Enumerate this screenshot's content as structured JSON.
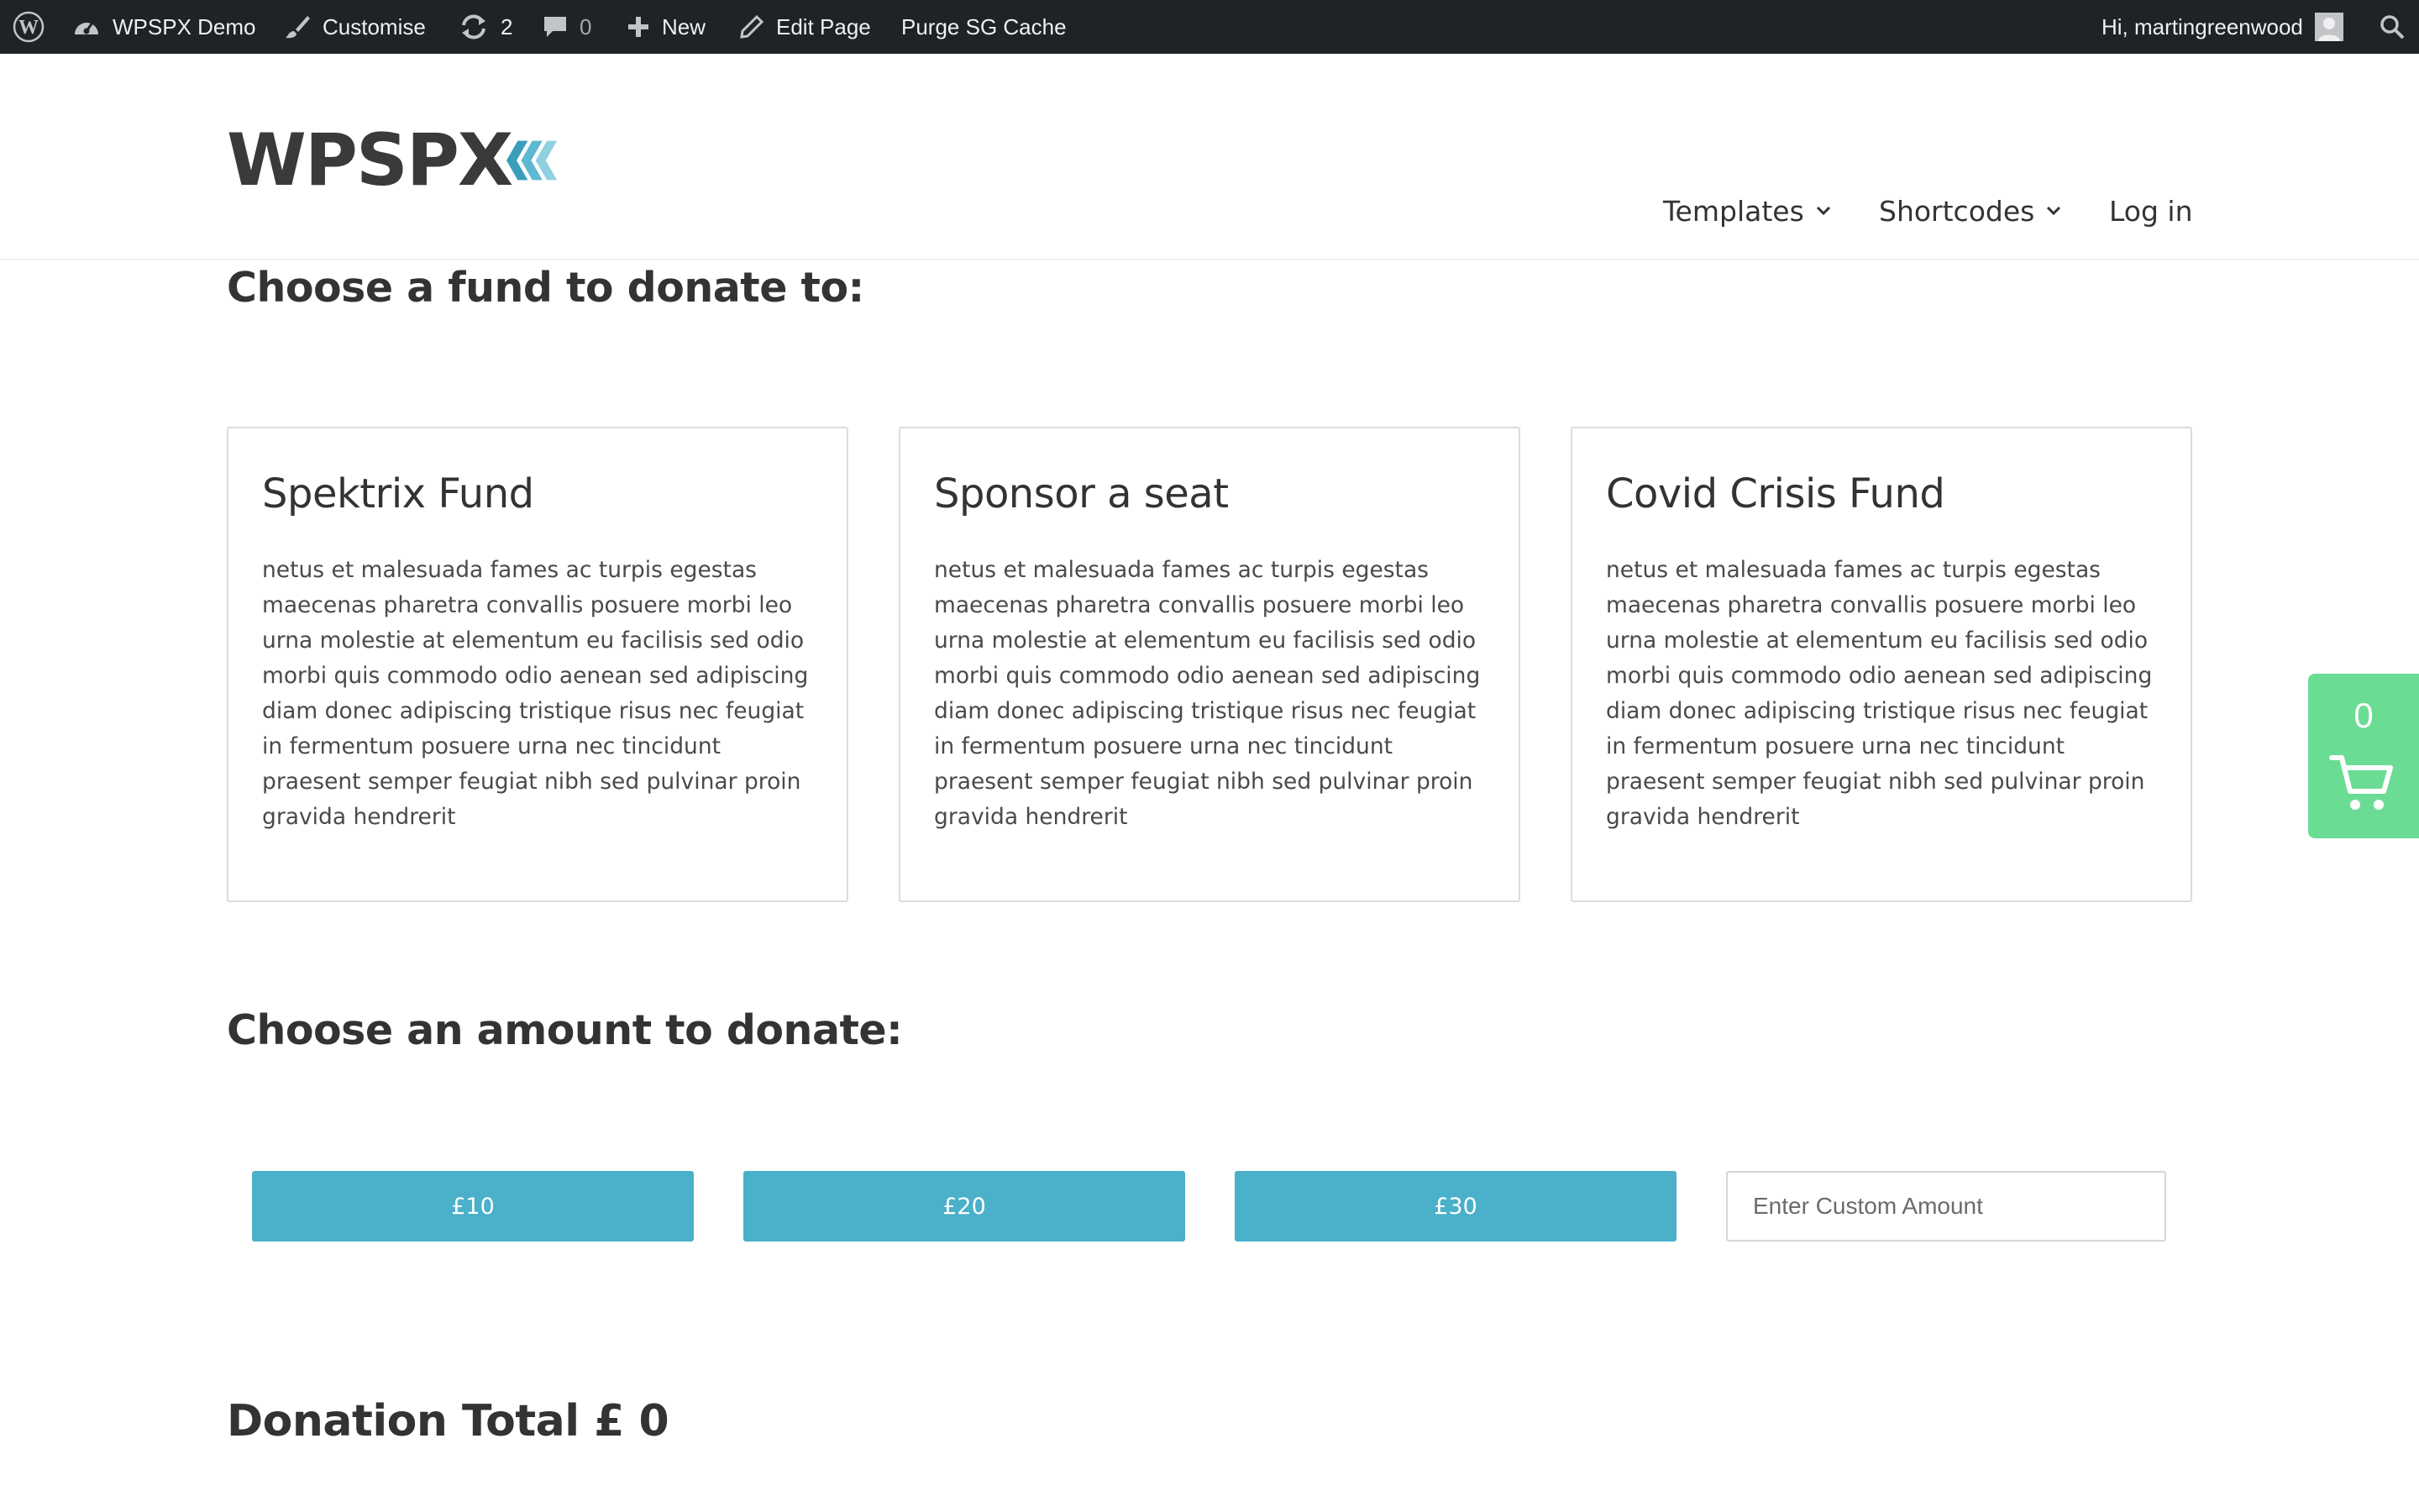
{
  "admin_bar": {
    "site_name": "WPSPX Demo",
    "customise": "Customise",
    "updates_count": "2",
    "comments_count": "0",
    "new_label": "New",
    "edit_page": "Edit Page",
    "purge_cache": "Purge SG Cache",
    "greeting": "Hi, martingreenwood"
  },
  "header": {
    "logo_text": "WPSPX",
    "nav": [
      {
        "label": "Templates"
      },
      {
        "label": "Shortcodes"
      },
      {
        "label": "Log in"
      }
    ]
  },
  "funds": {
    "title": "Choose a fund to donate to:",
    "cards": [
      {
        "title": "Spektrix Fund",
        "text": "netus et malesuada fames ac turpis egestas maecenas pharetra convallis posuere morbi leo urna molestie at elementum eu facilisis sed odio morbi quis commodo odio aenean sed adipiscing diam donec adipiscing tristique risus nec feugiat in fermentum posuere urna nec tincidunt praesent semper feugiat nibh sed pulvinar proin gravida hendrerit"
      },
      {
        "title": "Sponsor a seat",
        "text": "netus et malesuada fames ac turpis egestas maecenas pharetra convallis posuere morbi leo urna molestie at elementum eu facilisis sed odio morbi quis commodo odio aenean sed adipiscing diam donec adipiscing tristique risus nec feugiat in fermentum posuere urna nec tincidunt praesent semper feugiat nibh sed pulvinar proin gravida hendrerit"
      },
      {
        "title": "Covid Crisis Fund",
        "text": "netus et malesuada fames ac turpis egestas maecenas pharetra convallis posuere morbi leo urna molestie at elementum eu facilisis sed odio morbi quis commodo odio aenean sed adipiscing diam donec adipiscing tristique risus nec feugiat in fermentum posuere urna nec tincidunt praesent semper feugiat nibh sed pulvinar proin gravida hendrerit"
      }
    ]
  },
  "amounts": {
    "title": "Choose an amount to donate:",
    "buttons": [
      "£10",
      "£20",
      "£30"
    ],
    "custom_placeholder": "Enter Custom Amount",
    "custom_value": ""
  },
  "total": {
    "label": "Donation Total £ 0"
  },
  "cart": {
    "count": "0",
    "icon": "cart-icon"
  },
  "colors": {
    "admin_bar": "#1d2327",
    "accent_button": "#4bb0c9",
    "cart": "#6bdc94",
    "logo_chevron_dark": "#3a9dbb",
    "logo_chevron_light": "#8fd1e1"
  }
}
